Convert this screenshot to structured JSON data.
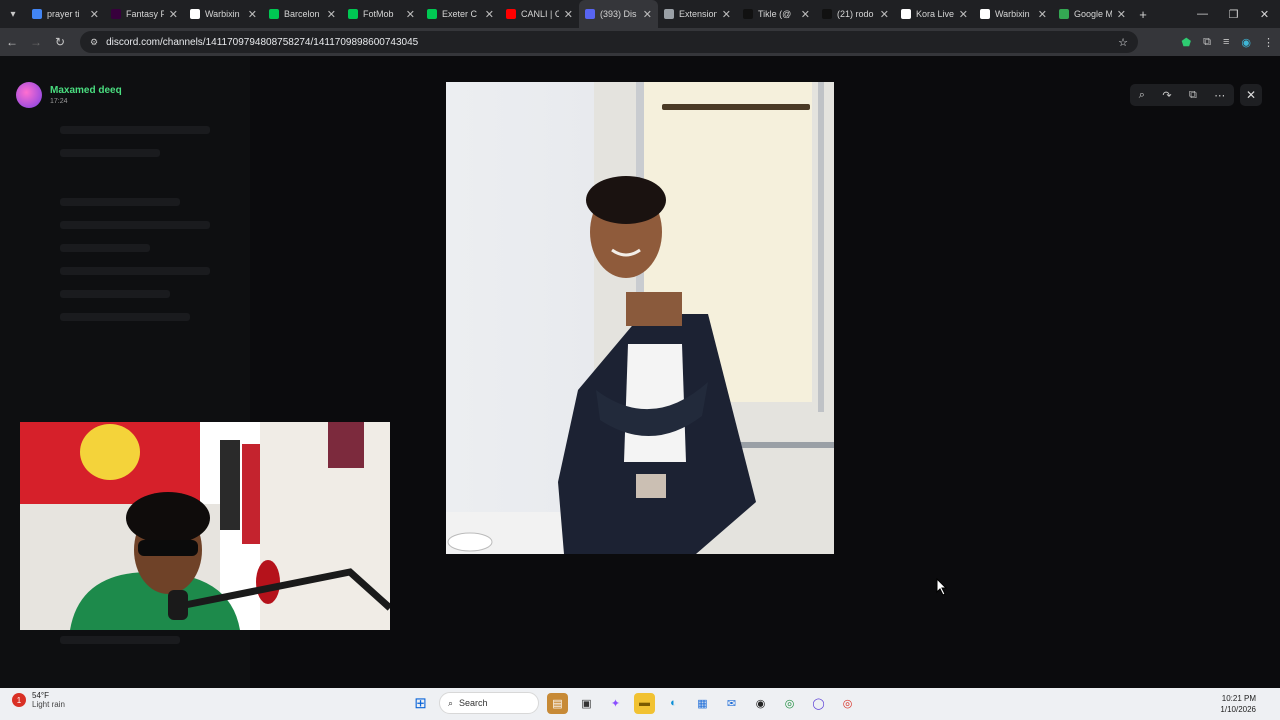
{
  "browser": {
    "tabs": [
      {
        "label": "prayer ti",
        "color": "#4285f4"
      },
      {
        "label": "Fantasy P",
        "color": "#37003c"
      },
      {
        "label": "Warbixin",
        "color": "#ffffff"
      },
      {
        "label": "Barcelon",
        "color": "#00c853"
      },
      {
        "label": "FotMob",
        "color": "#00c853"
      },
      {
        "label": "Exeter C",
        "color": "#00c853"
      },
      {
        "label": "CANLI | C",
        "color": "#ff0000"
      },
      {
        "label": "(393) Dis",
        "color": "#5865f2"
      },
      {
        "label": "Extension",
        "color": "#9aa0a6"
      },
      {
        "label": "Tikle (@",
        "color": "#111111"
      },
      {
        "label": "(21) rodo",
        "color": "#111111"
      },
      {
        "label": "Kora Live",
        "color": "#ffffff"
      },
      {
        "label": "Warbixin",
        "color": "#ffffff"
      },
      {
        "label": "Google M",
        "color": "#34a853"
      }
    ],
    "url": "discord.com/channels/1411709794808758274/1411709898600743045"
  },
  "viewer": {
    "poster_name": "Maxamed deeq",
    "poster_time": "17:24"
  },
  "taskbar": {
    "weather_temp": "54°F",
    "weather_cond": "Light rain",
    "search_label": "Search",
    "time": "10:21 PM",
    "date": "1/10/2026"
  }
}
